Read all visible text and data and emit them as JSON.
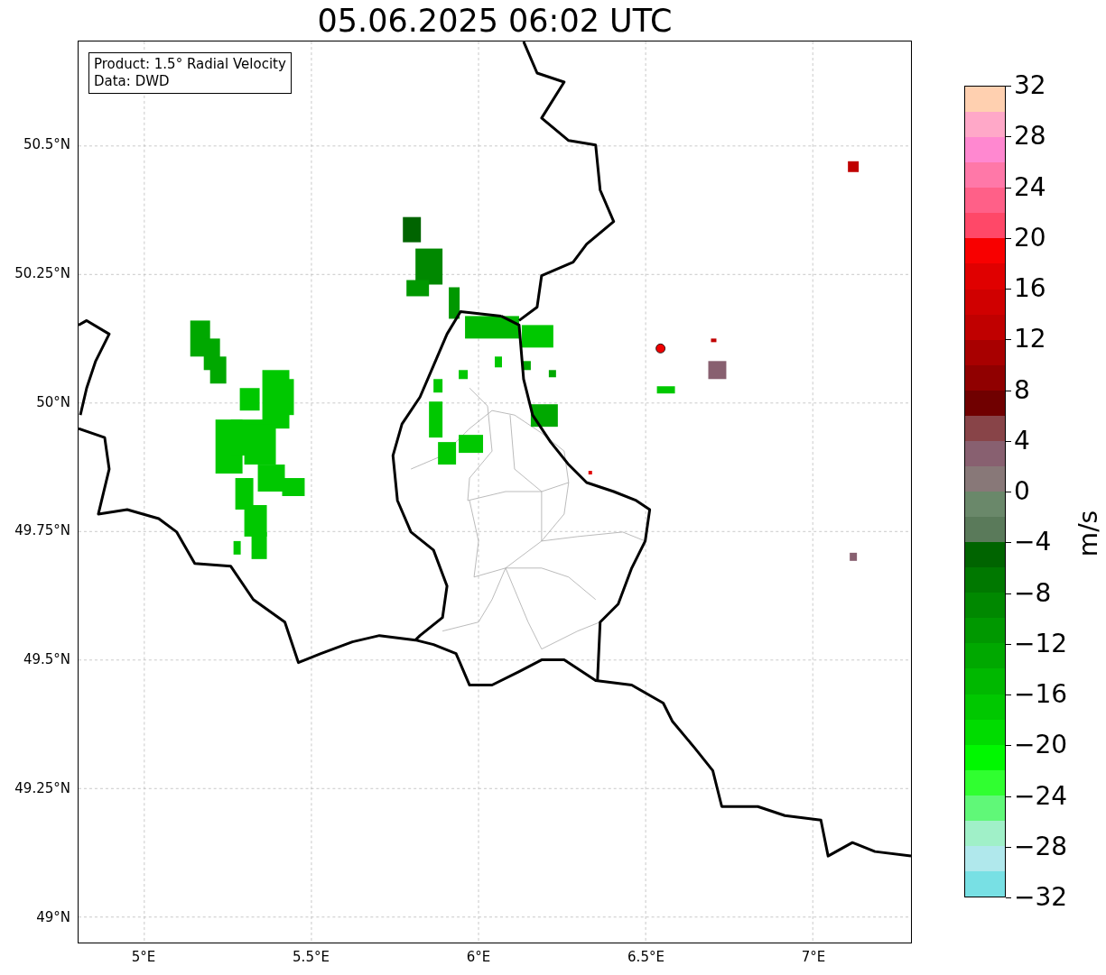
{
  "title": "05.06.2025 06:02 UTC",
  "info_box": [
    "Product: 1.5° Radial Velocity",
    "Data: DWD"
  ],
  "map": {
    "lat_labels": [
      "50.5°N",
      "50.25°N",
      "50°N",
      "49.75°N",
      "49.5°N",
      "49.25°N",
      "49°N"
    ],
    "lon_labels": [
      "5°E",
      "5.5°E",
      "6°E",
      "6.5°E",
      "7°E"
    ]
  },
  "colorbar": {
    "unit": "m/s",
    "ticks": [
      "32",
      "28",
      "24",
      "20",
      "16",
      "12",
      "8",
      "4",
      "0",
      "−4",
      "−8",
      "−12",
      "−16",
      "−20",
      "−24",
      "−28",
      "−32"
    ],
    "bands": [
      {
        "color": "#ffd0b0"
      },
      {
        "color": "#ffa8c8"
      },
      {
        "color": "#ff88d0"
      },
      {
        "color": "#ff78a8"
      },
      {
        "color": "#ff6088"
      },
      {
        "color": "#ff4868"
      },
      {
        "color": "#f80000"
      },
      {
        "color": "#e00000"
      },
      {
        "color": "#d00000"
      },
      {
        "color": "#c00000"
      },
      {
        "color": "#a80000"
      },
      {
        "color": "#900000"
      },
      {
        "color": "#700000"
      },
      {
        "color": "#884448"
      },
      {
        "color": "#886070"
      },
      {
        "color": "#887878"
      },
      {
        "color": "#6a886a"
      },
      {
        "color": "#5a7a5a"
      },
      {
        "color": "#006400"
      },
      {
        "color": "#007800"
      },
      {
        "color": "#008800"
      },
      {
        "color": "#009800"
      },
      {
        "color": "#00a800"
      },
      {
        "color": "#00b800"
      },
      {
        "color": "#00c800"
      },
      {
        "color": "#00dc00"
      },
      {
        "color": "#00f800"
      },
      {
        "color": "#30ff30"
      },
      {
        "color": "#60f878"
      },
      {
        "color": "#a0f0c8"
      },
      {
        "color": "#b0e8ec"
      },
      {
        "color": "#78e0e4"
      }
    ]
  }
}
